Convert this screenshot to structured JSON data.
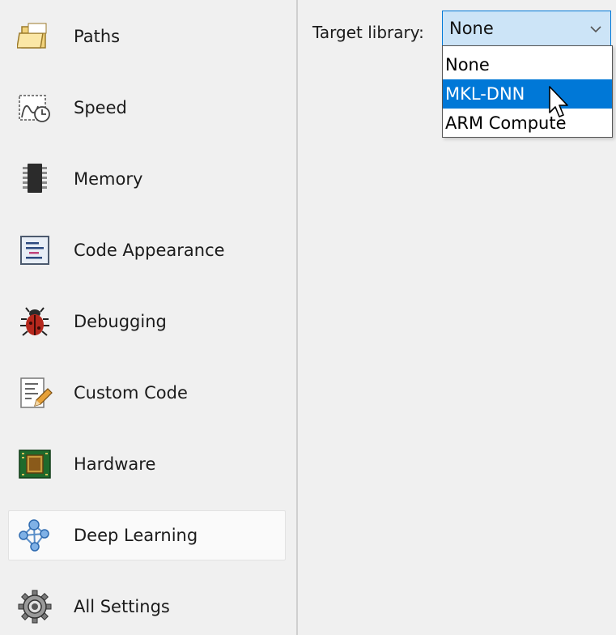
{
  "sidebar": {
    "items": [
      {
        "label": "Paths",
        "icon": "folder-icon",
        "selected": false
      },
      {
        "label": "Speed",
        "icon": "speed-clock-icon",
        "selected": false
      },
      {
        "label": "Memory",
        "icon": "memory-chip-icon",
        "selected": false
      },
      {
        "label": "Code Appearance",
        "icon": "code-appearance-icon",
        "selected": false
      },
      {
        "label": "Debugging",
        "icon": "bug-icon",
        "selected": false
      },
      {
        "label": "Custom Code",
        "icon": "custom-code-icon",
        "selected": false
      },
      {
        "label": "Hardware",
        "icon": "hardware-board-icon",
        "selected": false
      },
      {
        "label": "Deep Learning",
        "icon": "deep-learning-network-icon",
        "selected": true
      },
      {
        "label": "All Settings",
        "icon": "gear-icon",
        "selected": false
      }
    ]
  },
  "main": {
    "target_library": {
      "label": "Target library:",
      "selected_value": "None",
      "options": [
        "None",
        "MKL-DNN",
        "ARM Compute"
      ],
      "highlighted_option": "MKL-DNN"
    }
  },
  "colors": {
    "selection_blue": "#0078d7",
    "combo_focus_bg": "#cce4f7",
    "panel_bg": "#f0f0f0"
  }
}
